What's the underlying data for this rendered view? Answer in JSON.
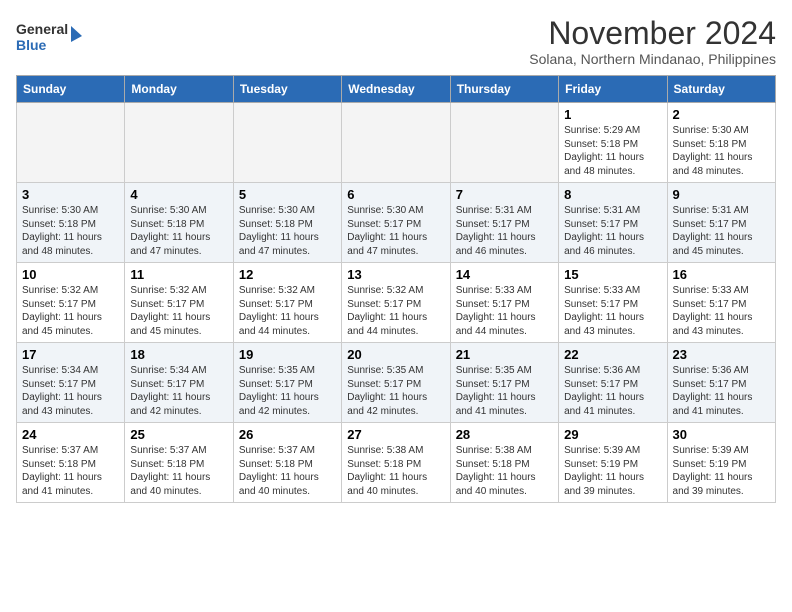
{
  "header": {
    "logo_line1": "General",
    "logo_line2": "Blue",
    "month": "November 2024",
    "location": "Solana, Northern Mindanao, Philippines"
  },
  "weekdays": [
    "Sunday",
    "Monday",
    "Tuesday",
    "Wednesday",
    "Thursday",
    "Friday",
    "Saturday"
  ],
  "weeks": [
    [
      {
        "day": "",
        "info": ""
      },
      {
        "day": "",
        "info": ""
      },
      {
        "day": "",
        "info": ""
      },
      {
        "day": "",
        "info": ""
      },
      {
        "day": "",
        "info": ""
      },
      {
        "day": "1",
        "info": "Sunrise: 5:29 AM\nSunset: 5:18 PM\nDaylight: 11 hours and 48 minutes."
      },
      {
        "day": "2",
        "info": "Sunrise: 5:30 AM\nSunset: 5:18 PM\nDaylight: 11 hours and 48 minutes."
      }
    ],
    [
      {
        "day": "3",
        "info": "Sunrise: 5:30 AM\nSunset: 5:18 PM\nDaylight: 11 hours and 48 minutes."
      },
      {
        "day": "4",
        "info": "Sunrise: 5:30 AM\nSunset: 5:18 PM\nDaylight: 11 hours and 47 minutes."
      },
      {
        "day": "5",
        "info": "Sunrise: 5:30 AM\nSunset: 5:18 PM\nDaylight: 11 hours and 47 minutes."
      },
      {
        "day": "6",
        "info": "Sunrise: 5:30 AM\nSunset: 5:17 PM\nDaylight: 11 hours and 47 minutes."
      },
      {
        "day": "7",
        "info": "Sunrise: 5:31 AM\nSunset: 5:17 PM\nDaylight: 11 hours and 46 minutes."
      },
      {
        "day": "8",
        "info": "Sunrise: 5:31 AM\nSunset: 5:17 PM\nDaylight: 11 hours and 46 minutes."
      },
      {
        "day": "9",
        "info": "Sunrise: 5:31 AM\nSunset: 5:17 PM\nDaylight: 11 hours and 45 minutes."
      }
    ],
    [
      {
        "day": "10",
        "info": "Sunrise: 5:32 AM\nSunset: 5:17 PM\nDaylight: 11 hours and 45 minutes."
      },
      {
        "day": "11",
        "info": "Sunrise: 5:32 AM\nSunset: 5:17 PM\nDaylight: 11 hours and 45 minutes."
      },
      {
        "day": "12",
        "info": "Sunrise: 5:32 AM\nSunset: 5:17 PM\nDaylight: 11 hours and 44 minutes."
      },
      {
        "day": "13",
        "info": "Sunrise: 5:32 AM\nSunset: 5:17 PM\nDaylight: 11 hours and 44 minutes."
      },
      {
        "day": "14",
        "info": "Sunrise: 5:33 AM\nSunset: 5:17 PM\nDaylight: 11 hours and 44 minutes."
      },
      {
        "day": "15",
        "info": "Sunrise: 5:33 AM\nSunset: 5:17 PM\nDaylight: 11 hours and 43 minutes."
      },
      {
        "day": "16",
        "info": "Sunrise: 5:33 AM\nSunset: 5:17 PM\nDaylight: 11 hours and 43 minutes."
      }
    ],
    [
      {
        "day": "17",
        "info": "Sunrise: 5:34 AM\nSunset: 5:17 PM\nDaylight: 11 hours and 43 minutes."
      },
      {
        "day": "18",
        "info": "Sunrise: 5:34 AM\nSunset: 5:17 PM\nDaylight: 11 hours and 42 minutes."
      },
      {
        "day": "19",
        "info": "Sunrise: 5:35 AM\nSunset: 5:17 PM\nDaylight: 11 hours and 42 minutes."
      },
      {
        "day": "20",
        "info": "Sunrise: 5:35 AM\nSunset: 5:17 PM\nDaylight: 11 hours and 42 minutes."
      },
      {
        "day": "21",
        "info": "Sunrise: 5:35 AM\nSunset: 5:17 PM\nDaylight: 11 hours and 41 minutes."
      },
      {
        "day": "22",
        "info": "Sunrise: 5:36 AM\nSunset: 5:17 PM\nDaylight: 11 hours and 41 minutes."
      },
      {
        "day": "23",
        "info": "Sunrise: 5:36 AM\nSunset: 5:17 PM\nDaylight: 11 hours and 41 minutes."
      }
    ],
    [
      {
        "day": "24",
        "info": "Sunrise: 5:37 AM\nSunset: 5:18 PM\nDaylight: 11 hours and 41 minutes."
      },
      {
        "day": "25",
        "info": "Sunrise: 5:37 AM\nSunset: 5:18 PM\nDaylight: 11 hours and 40 minutes."
      },
      {
        "day": "26",
        "info": "Sunrise: 5:37 AM\nSunset: 5:18 PM\nDaylight: 11 hours and 40 minutes."
      },
      {
        "day": "27",
        "info": "Sunrise: 5:38 AM\nSunset: 5:18 PM\nDaylight: 11 hours and 40 minutes."
      },
      {
        "day": "28",
        "info": "Sunrise: 5:38 AM\nSunset: 5:18 PM\nDaylight: 11 hours and 40 minutes."
      },
      {
        "day": "29",
        "info": "Sunrise: 5:39 AM\nSunset: 5:19 PM\nDaylight: 11 hours and 39 minutes."
      },
      {
        "day": "30",
        "info": "Sunrise: 5:39 AM\nSunset: 5:19 PM\nDaylight: 11 hours and 39 minutes."
      }
    ]
  ]
}
